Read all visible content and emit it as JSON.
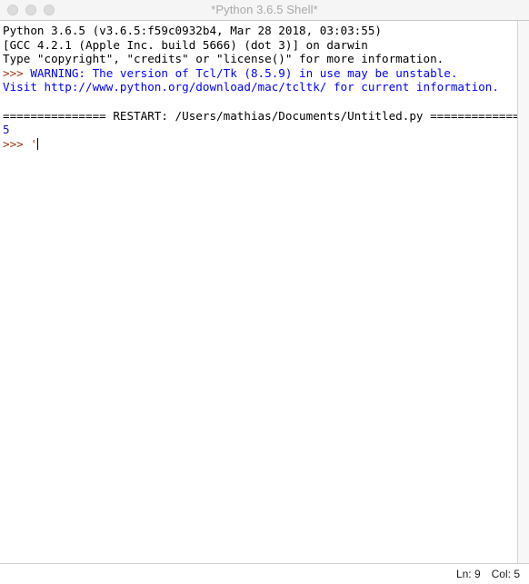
{
  "window": {
    "title": "*Python 3.6.5 Shell*",
    "traffic_lights": [
      {
        "name": "close",
        "color": "#dcdcdc"
      },
      {
        "name": "minimize",
        "color": "#dcdcdc"
      },
      {
        "name": "zoom",
        "color": "#dcdcdc"
      }
    ]
  },
  "shell": {
    "lines": [
      {
        "id": "banner-version",
        "segments": [
          {
            "text": "Python 3.6.5 (v3.6.5:f59c0932b4, Mar 28 2018, 03:03:55)",
            "color": "black"
          }
        ]
      },
      {
        "id": "banner-compiler",
        "segments": [
          {
            "text": "[GCC 4.2.1 (Apple Inc. build 5666) (dot 3)] on darwin",
            "color": "black"
          }
        ]
      },
      {
        "id": "banner-help",
        "segments": [
          {
            "text": "Type \"copyright\", \"credits\" or \"license()\" for more information.",
            "color": "black"
          }
        ]
      },
      {
        "id": "warning-tcltk",
        "segments": [
          {
            "text": ">>> ",
            "color": "prompt"
          },
          {
            "text": "WARNING: The version of Tcl/Tk (8.5.9) in use may be unstable.",
            "color": "blue"
          }
        ]
      },
      {
        "id": "warning-visit",
        "segments": [
          {
            "text": "Visit http://www.python.org/download/mac/tcltk/ for current information.",
            "color": "blue"
          }
        ]
      },
      {
        "id": "blank-1",
        "segments": [
          {
            "text": " ",
            "color": "black"
          }
        ]
      },
      {
        "id": "restart-banner",
        "segments": [
          {
            "text": "=============== RESTART: /Users/mathias/Documents/Untitled.py ===============",
            "color": "black"
          }
        ]
      },
      {
        "id": "program-output",
        "segments": [
          {
            "text": "5",
            "color": "stdout"
          }
        ]
      }
    ],
    "prompt": {
      "prompt_text": ">>> ",
      "input_text": "'"
    }
  },
  "statusbar": {
    "line_label": "Ln: 9",
    "col_label": "Col: 5"
  }
}
